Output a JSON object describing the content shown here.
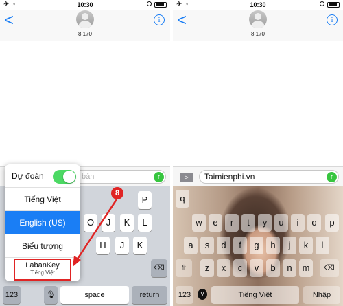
{
  "status_bar": {
    "time": "10:30"
  },
  "conversation": {
    "contact": "8 170",
    "back_label": "<",
    "info_label": "i"
  },
  "left": {
    "input_placeholder": "bản",
    "keys_row2": [
      "P",
      "O",
      "J",
      "K",
      "L"
    ],
    "keys_row3": [
      "H",
      "J",
      "K"
    ],
    "key_123": "123",
    "key_space": "space",
    "key_return": "return",
    "popup": {
      "prediction_label": "Dự đoán",
      "prediction_on": true,
      "items": [
        "Tiếng Việt",
        "English (US)",
        "Biểu tượng"
      ],
      "selected": "English (US)",
      "labankey_title": "LabanKey",
      "labankey_subtitle": "Tiếng Việt"
    },
    "step_badge": "8"
  },
  "right": {
    "input_value": "Taimienphi.vn",
    "keys_row1": [
      "w",
      "e",
      "r",
      "t",
      "y",
      "u",
      "i",
      "o",
      "p"
    ],
    "keys_row1_first": "q",
    "keys_row2": [
      "a",
      "s",
      "d",
      "f",
      "g",
      "h",
      "j",
      "k",
      "l"
    ],
    "keys_row3": [
      "z",
      "x",
      "c",
      "v",
      "b",
      "n",
      "m"
    ],
    "key_123": "123",
    "key_v": "V",
    "key_space": "Tiếng Việt",
    "key_return": "Nhập"
  },
  "colors": {
    "accent": "#1a7ef5",
    "send": "#37c53f",
    "highlight": "#e02424"
  }
}
